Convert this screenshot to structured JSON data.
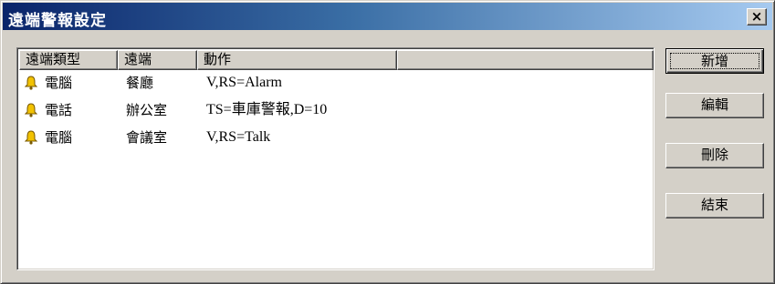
{
  "window": {
    "title": "遠端警報設定",
    "close_label": "×"
  },
  "list": {
    "columns": [
      "遠端類型",
      "遠端",
      "動作",
      ""
    ],
    "rows": [
      {
        "icon": "bell-icon",
        "type": "電腦",
        "remote": "餐廳",
        "action": "V,RS=Alarm"
      },
      {
        "icon": "bell-icon",
        "type": "電話",
        "remote": "辦公室",
        "action": "TS=車庫警報,D=10"
      },
      {
        "icon": "bell-icon",
        "type": "電腦",
        "remote": "會議室",
        "action": "V,RS=Talk"
      }
    ]
  },
  "buttons": {
    "add": "新增",
    "edit": "編輯",
    "delete": "刪除",
    "close": "結束"
  },
  "colors": {
    "titlebar_start": "#0a246a",
    "titlebar_end": "#a6caf0",
    "face": "#d4d0c8",
    "bell": "#f2c200"
  }
}
